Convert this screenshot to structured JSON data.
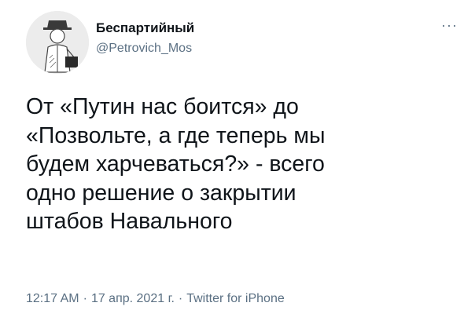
{
  "tweet": {
    "author_name": "Беспартийный",
    "author_handle": "@Petrovich_Mos",
    "more_glyph": "···",
    "text_lines": [
      "От «Путин нас боится» до",
      "«Позвольте, а где теперь мы",
      "будем харчеваться?» - всего",
      "одно решение о закрытии",
      "штабов Навального"
    ],
    "time": "12:17 AM",
    "separator": "·",
    "date": "17 апр. 2021 г.",
    "source": "Twitter for iPhone"
  },
  "icons": {
    "avatar": "avatar-drawing-icon",
    "more": "more-options-icon"
  },
  "colors": {
    "text": "#0f1419",
    "secondary": "#5b7083",
    "background": "#ffffff"
  }
}
